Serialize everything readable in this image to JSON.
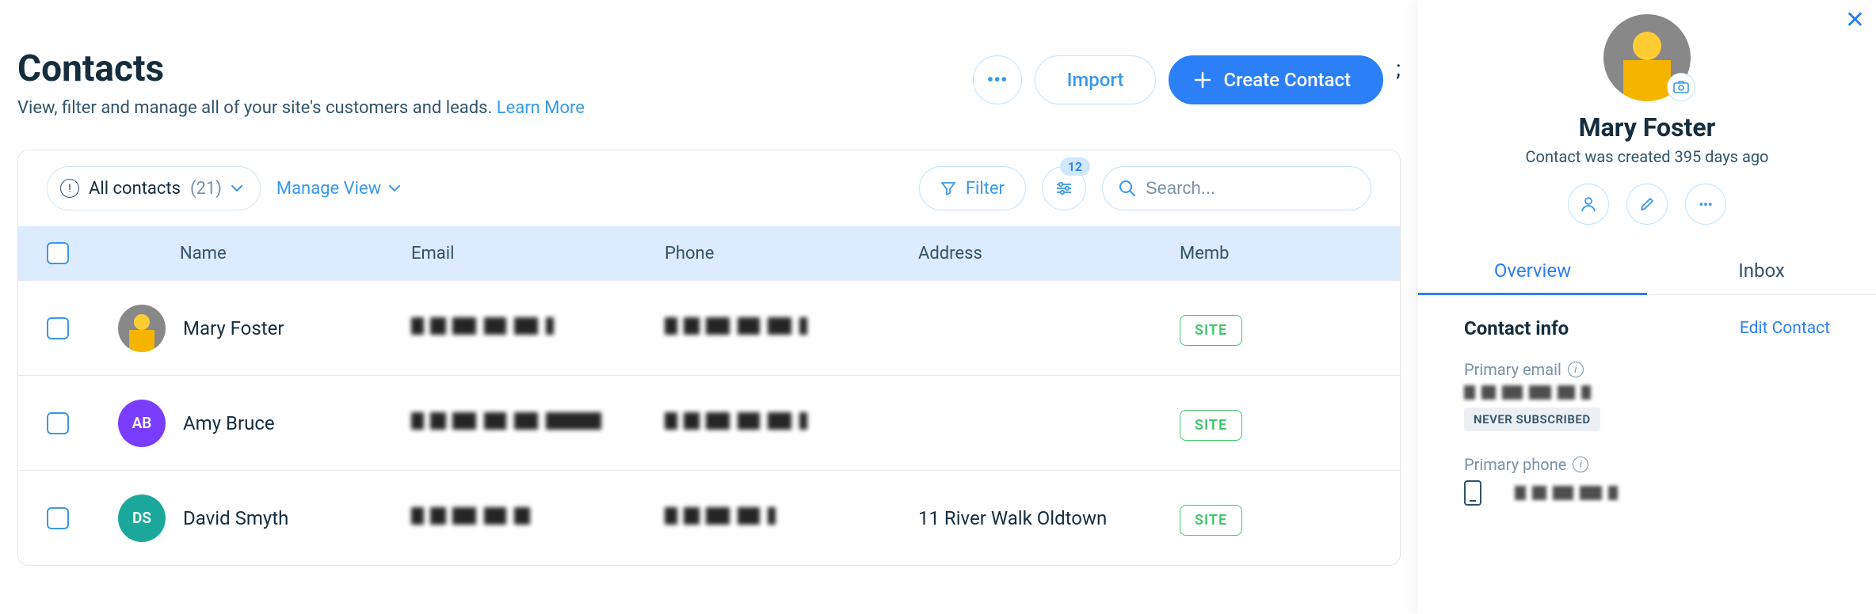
{
  "header": {
    "title": "Contacts",
    "subtitle": "View, filter and manage all of your site's customers and leads. ",
    "learn_more": "Learn More",
    "import_label": "Import",
    "create_label": "Create Contact"
  },
  "toolbar": {
    "view_label": "All contacts",
    "view_count": "(21)",
    "manage_view_label": "Manage View",
    "filter_label": "Filter",
    "sliders_badge": "12",
    "search_placeholder": "Search..."
  },
  "table": {
    "columns": {
      "name": "Name",
      "email": "Email",
      "phone": "Phone",
      "address": "Address",
      "member": "Memb"
    },
    "rows": [
      {
        "name": "Mary Foster",
        "email": "(redacted)",
        "phone": "(redacted)",
        "address": "",
        "avatar_type": "image",
        "avatar_initials": "",
        "avatar_color": "",
        "badge": "SITE"
      },
      {
        "name": "Amy Bruce",
        "email": "(redacted)",
        "phone": "(redacted)",
        "address": "",
        "avatar_type": "initials",
        "avatar_initials": "AB",
        "avatar_color": "#7A3CFF",
        "badge": "SITE"
      },
      {
        "name": "David Smyth",
        "email": "(redacted)",
        "phone": "(redacted)",
        "address": "11 River Walk Oldtown",
        "avatar_type": "initials",
        "avatar_initials": "DS",
        "avatar_color": "#1AA89C",
        "badge": "SITE"
      }
    ]
  },
  "panel": {
    "name": "Mary Foster",
    "created": "Contact was created 395 days ago",
    "tabs": {
      "overview": "Overview",
      "inbox": "Inbox"
    },
    "section_title": "Contact info",
    "edit_label": "Edit Contact",
    "primary_email_label": "Primary email",
    "primary_email_value": "(redacted)",
    "subscribe_tag": "NEVER SUBSCRIBED",
    "primary_phone_label": "Primary phone",
    "primary_phone_value": "(redacted)"
  }
}
